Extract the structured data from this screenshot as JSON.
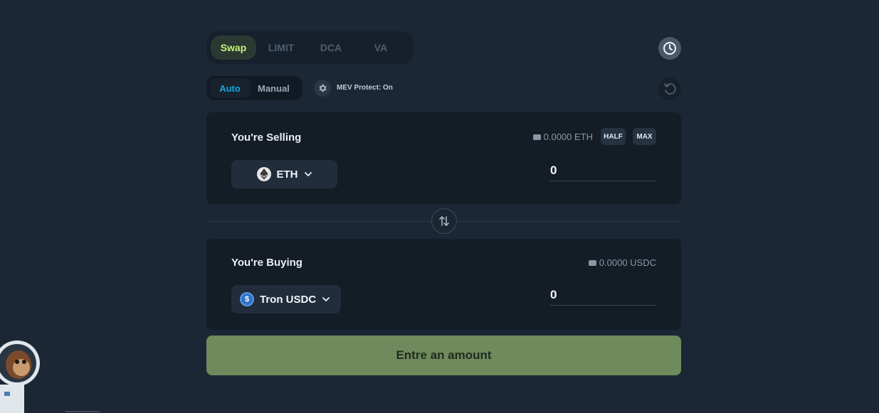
{
  "mode_tabs": [
    {
      "label": "Swap",
      "active": true
    },
    {
      "label": "LIMIT",
      "active": false
    },
    {
      "label": "DCA",
      "active": false
    },
    {
      "label": "VA",
      "active": false
    }
  ],
  "route": {
    "auto_label": "Auto",
    "manual_label": "Manual",
    "selected": "Auto"
  },
  "mev": {
    "text": "MEV Protect: On"
  },
  "sell": {
    "label": "You're Selling",
    "balance": "0.0000 ETH",
    "half_label": "HALF",
    "max_label": "MAX",
    "token": "ETH",
    "token_icon": "ethereum-icon",
    "amount": "0"
  },
  "buy": {
    "label": "You're Buying",
    "balance": "0.0000 USDC",
    "token": "Tron USDC",
    "token_icon": "usdc-icon",
    "amount": "0"
  },
  "cta": {
    "label": "Entre an amount"
  },
  "colors": {
    "background": "#1b2735",
    "accent_green": "#c6f27a",
    "accent_blue": "#18a8d8",
    "cta_bg": "#6f8a5c"
  }
}
